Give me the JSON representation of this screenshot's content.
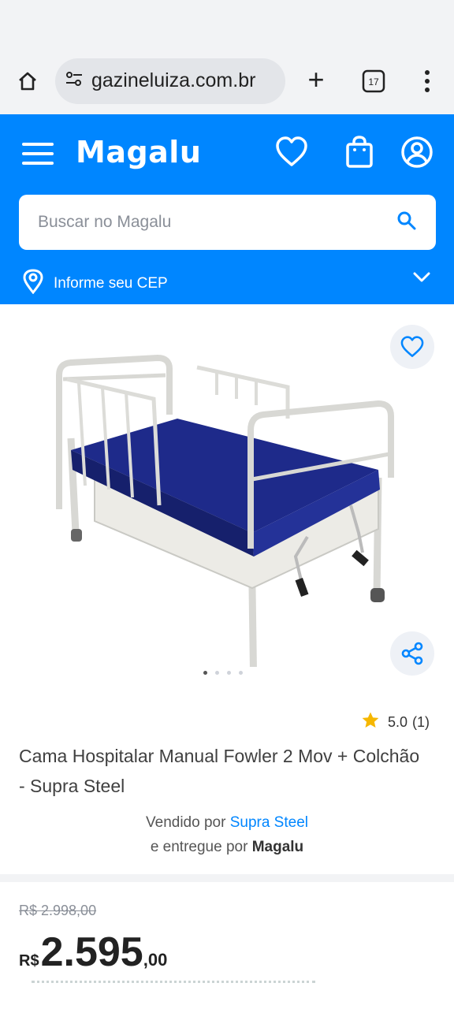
{
  "browser": {
    "url": "gazineluiza.com.br",
    "tab_count": "17"
  },
  "header": {
    "logo": "Magalu",
    "search_placeholder": "Buscar no Magalu",
    "cep_label": "Informe seu CEP"
  },
  "product": {
    "title": "Cama Hospitalar Manual Fowler 2 Mov + Colchão - Supra Steel",
    "rating": "5.0",
    "rating_count": "(1)",
    "sold_by_prefix": "Vendido por",
    "seller": "Supra Steel",
    "delivered_by_prefix": "e entregue por",
    "delivered_by": "Magalu",
    "image_count": 4,
    "image_index": 1,
    "old_price": "R$ 2.998,00",
    "price_currency": "R$",
    "price_int": "2.595",
    "price_cents": ",00"
  },
  "colors": {
    "brand_blue": "#0086ff",
    "mattress_blue": "#1e2a8a"
  }
}
